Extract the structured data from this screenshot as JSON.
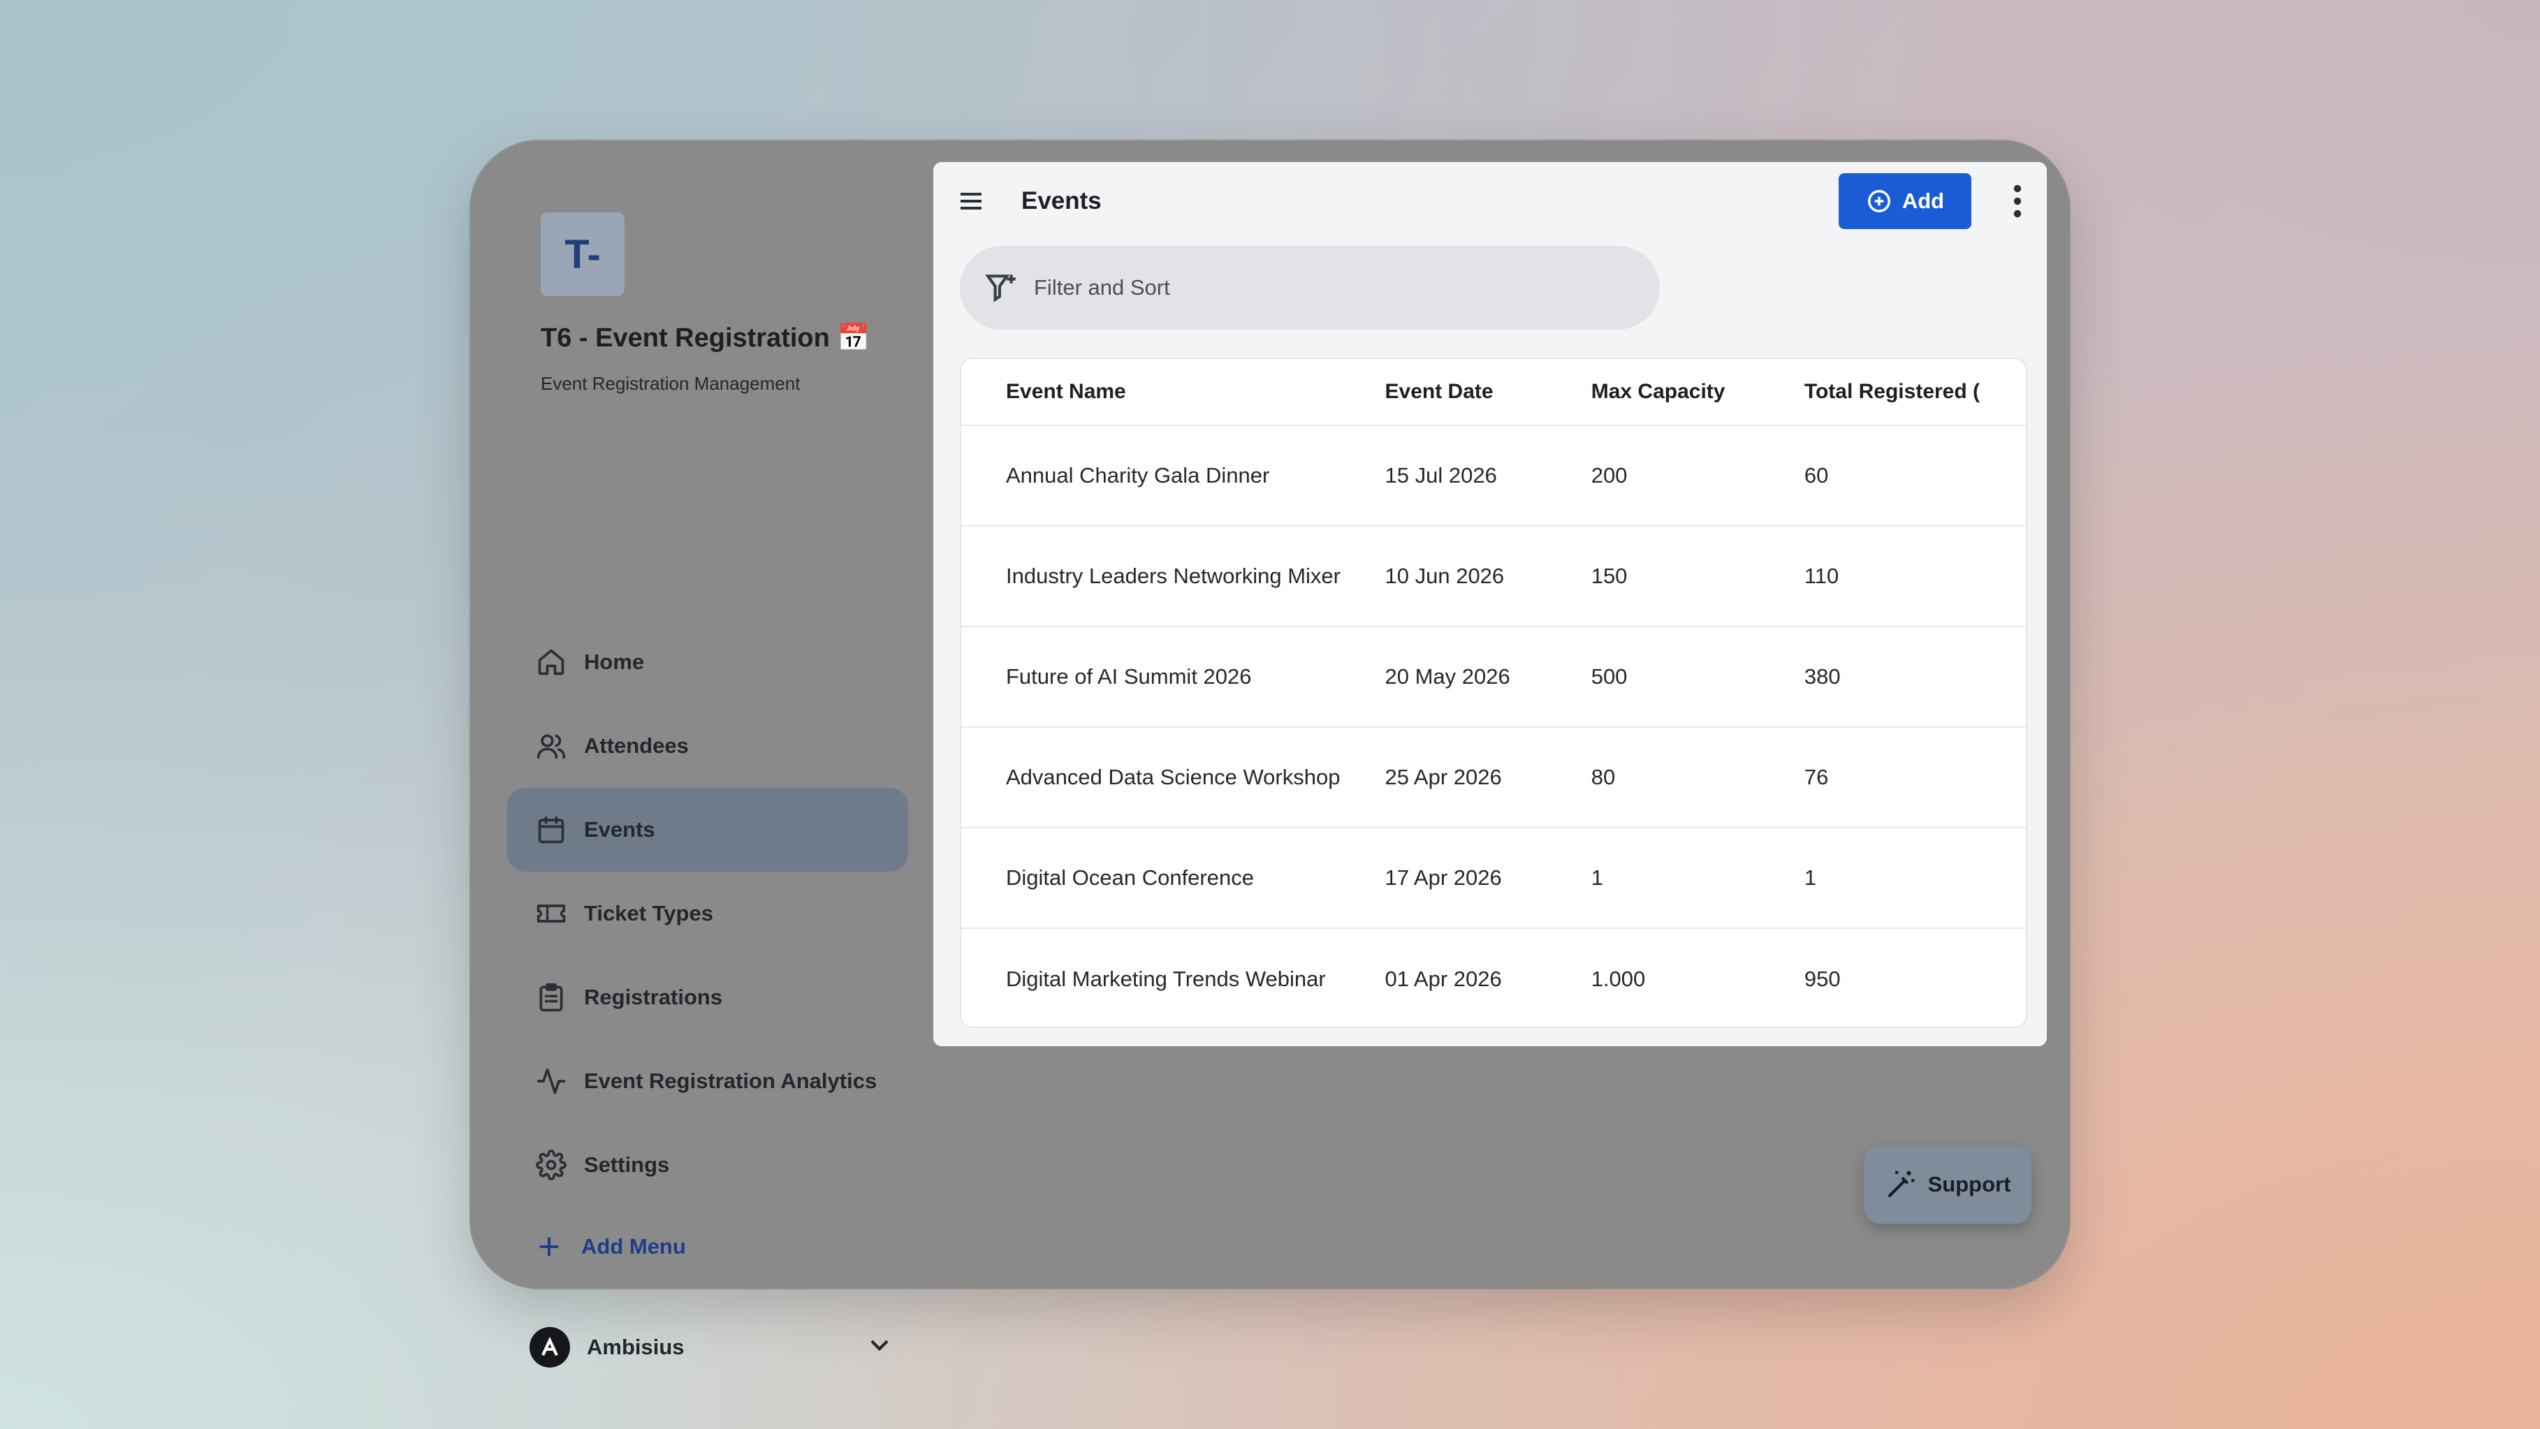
{
  "app": {
    "logo_text": "T-",
    "title": "T6 - Event Registration 📅",
    "subtitle": "Event Registration Management"
  },
  "sidebar": {
    "items": [
      {
        "label": "Home",
        "icon": "home-icon",
        "active": false
      },
      {
        "label": "Attendees",
        "icon": "users-icon",
        "active": false
      },
      {
        "label": "Events",
        "icon": "calendar-icon",
        "active": true
      },
      {
        "label": "Ticket Types",
        "icon": "ticket-icon",
        "active": false
      },
      {
        "label": "Registrations",
        "icon": "clipboard-icon",
        "active": false
      },
      {
        "label": "Event Registration Analytics",
        "icon": "activity-icon",
        "active": false
      },
      {
        "label": "Settings",
        "icon": "gear-icon",
        "active": false
      }
    ],
    "add_menu_label": "Add Menu",
    "account_name": "Ambisius"
  },
  "header": {
    "title": "Events",
    "add_label": "Add"
  },
  "filter": {
    "placeholder": "Filter and Sort"
  },
  "table": {
    "columns": [
      "Event Name",
      "Event Date",
      "Max Capacity",
      "Total Registered ("
    ],
    "rows": [
      {
        "name": "Annual Charity Gala Dinner",
        "date": "15 Jul 2026",
        "capacity": "200",
        "registered": "60"
      },
      {
        "name": "Industry Leaders Networking Mixer",
        "date": "10 Jun 2026",
        "capacity": "150",
        "registered": "110"
      },
      {
        "name": "Future of AI Summit 2026",
        "date": "20 May 2026",
        "capacity": "500",
        "registered": "380"
      },
      {
        "name": "Advanced Data Science Workshop",
        "date": "25 Apr 2026",
        "capacity": "80",
        "registered": "76"
      },
      {
        "name": "Digital Ocean Conference",
        "date": "17 Apr 2026",
        "capacity": "1",
        "registered": "1"
      },
      {
        "name": "Digital Marketing Trends Webinar",
        "date": "01 Apr 2026",
        "capacity": "1.000",
        "registered": "950"
      }
    ]
  },
  "support": {
    "label": "Support"
  },
  "colors": {
    "accent": "#1a5cd6",
    "active_nav": "#6f7b8a",
    "add_menu": "#1e3f86"
  }
}
